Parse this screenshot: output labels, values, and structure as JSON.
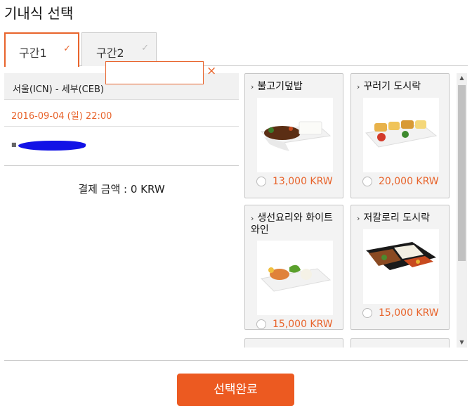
{
  "page": {
    "title": "기내식 선택"
  },
  "tabs": [
    {
      "label": "구간1",
      "check": "✓"
    },
    {
      "label": "구간2",
      "check": "✓"
    }
  ],
  "segment": {
    "route": "서울(ICN) - 세부(CEB)",
    "date": "2016-09-04 (일) 22:00"
  },
  "passenger": {
    "meal_value": "",
    "clear": "×"
  },
  "payment": {
    "total": "결제 금액 : 0 KRW"
  },
  "meals": [
    {
      "name": "불고기덮밥",
      "price": "13,000 KRW"
    },
    {
      "name": "꾸러기 도시락",
      "price": "20,000 KRW"
    },
    {
      "name": "생선요리와 화이트와인",
      "price": "15,000 KRW"
    },
    {
      "name": "저칼로리 도시락",
      "price": "15,000 KRW"
    }
  ],
  "actions": {
    "submit": "선택완료"
  },
  "colors": {
    "accent": "#e8642c",
    "button": "#ec5a21",
    "redaction": "#1212e6"
  }
}
